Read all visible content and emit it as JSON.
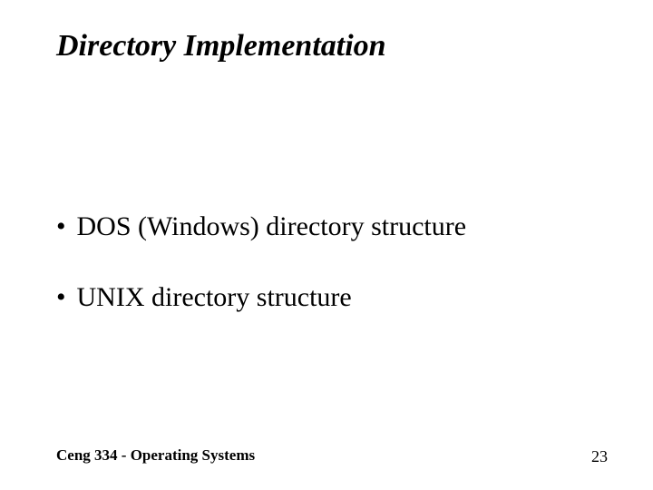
{
  "title": "Directory Implementation",
  "bullets": [
    {
      "text": "DOS (Windows) directory structure"
    },
    {
      "text": "UNIX directory structure"
    }
  ],
  "footer": {
    "left": "Ceng 334 - Operating Systems",
    "pageNumber": "23"
  }
}
